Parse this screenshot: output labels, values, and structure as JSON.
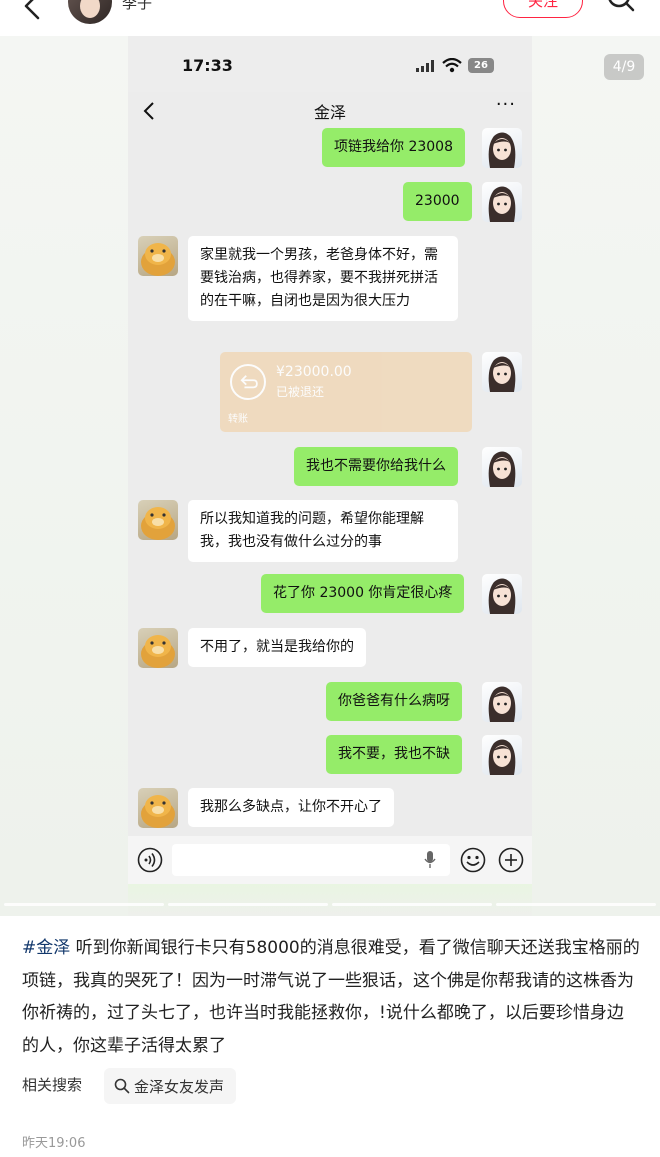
{
  "topbar": {
    "author_name": "李子",
    "follow_label": "关注"
  },
  "media": {
    "page_indicator": "4/9",
    "carousel_total": 9,
    "carousel_current": 4
  },
  "chat": {
    "status_time": "17:33",
    "battery": "26",
    "title": "金泽",
    "more": "···",
    "messages": [
      {
        "side": "right",
        "text": "项链我给你 23008"
      },
      {
        "side": "right",
        "text": "23000"
      },
      {
        "side": "left",
        "text": "家里就我一个男孩，老爸身体不好，需要钱治病，也得养家，要不我拼死拼活的在干嘛，自闭也是因为很大压力"
      },
      {
        "side": "right",
        "type": "transfer",
        "amount": "¥23000.00",
        "status": "已被退还",
        "label": "转账"
      },
      {
        "side": "right",
        "text": "我也不需要你给我什么"
      },
      {
        "side": "left",
        "text": "所以我知道我的问题，希望你能理解我，我也没有做什么过分的事"
      },
      {
        "side": "right",
        "text": "花了你 23000 你肯定很心疼"
      },
      {
        "side": "left",
        "text": "不用了，就当是我给你的"
      },
      {
        "side": "right",
        "text": "你爸爸有什么病呀"
      },
      {
        "side": "right",
        "text": "我不要，我也不缺"
      },
      {
        "side": "left",
        "text": "我那么多缺点，让你不开心了"
      }
    ]
  },
  "caption": {
    "hashtag": "#金泽",
    "text": " 听到你新闻银行卡只有58000的消息很难受，看了微信聊天还送我宝格丽的项链，我真的哭死了！因为一时滞气说了一些狠话，这个佛是你帮我请的这株香为你祈祷的，过了头七了，也许当时我能拯救你，!说什么都晚了，以后要珍惜身边的人，你这辈子活得太累了"
  },
  "related": {
    "label": "相关搜索",
    "chip": "金泽女友发声"
  },
  "timestamp": "昨天19:06",
  "colors": {
    "accent": "#ff2442",
    "hashtag": "#13386c",
    "wechat_green": "#95ec69",
    "transfer": "#f0d8b8"
  }
}
